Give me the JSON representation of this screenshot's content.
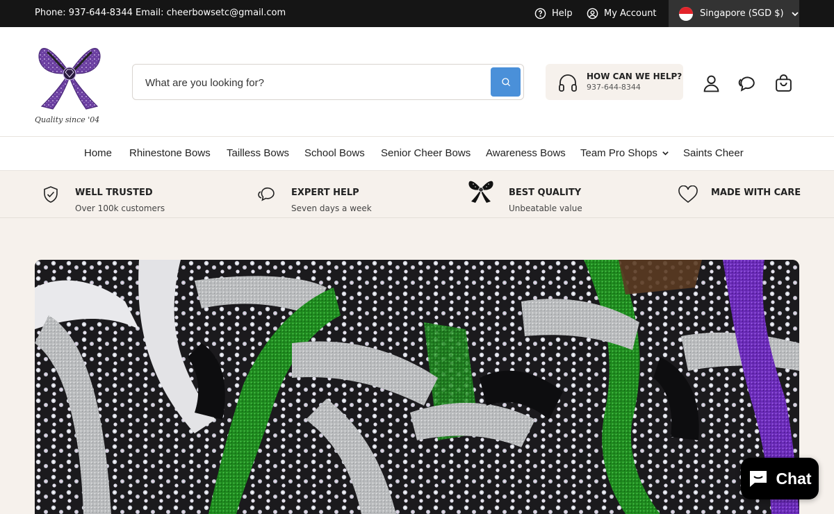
{
  "topbar": {
    "contact": "Phone: 937-644-8344 Email: cheerbowsetc@gmail.com",
    "help_label": "Help",
    "account_label": "My Account",
    "region_label": "Singapore (SGD $)"
  },
  "header": {
    "tagline": "Quality since '04",
    "search_placeholder": "What are you looking for?",
    "help_title": "HOW CAN WE HELP?",
    "help_phone": "937-644-8344"
  },
  "nav": {
    "items": [
      {
        "label": "Home"
      },
      {
        "label": "Rhinestone Bows"
      },
      {
        "label": "Tailless Bows"
      },
      {
        "label": "School Bows"
      },
      {
        "label": "Senior Cheer Bows"
      },
      {
        "label": "Awareness Bows"
      },
      {
        "label": "Team Pro Shops"
      },
      {
        "label": "Saints Cheer"
      }
    ]
  },
  "features": [
    {
      "title": "WELL TRUSTED",
      "subtitle": "Over 100k customers",
      "icon": "shield-check-icon"
    },
    {
      "title": "EXPERT HELP",
      "subtitle": "Seven days a week",
      "icon": "chat-bubbles-icon"
    },
    {
      "title": "BEST QUALITY",
      "subtitle": "Unbeatable value",
      "icon": "bow-icon"
    },
    {
      "title": "MADE WITH CARE",
      "subtitle": "",
      "icon": "heart-icon"
    }
  ],
  "chat": {
    "label": "Chat"
  },
  "colors": {
    "topbar_bg": "#151515",
    "page_bg": "#f6f1ec",
    "search_button": "#4a90d9",
    "logo_purple": "#6b3fa0"
  }
}
